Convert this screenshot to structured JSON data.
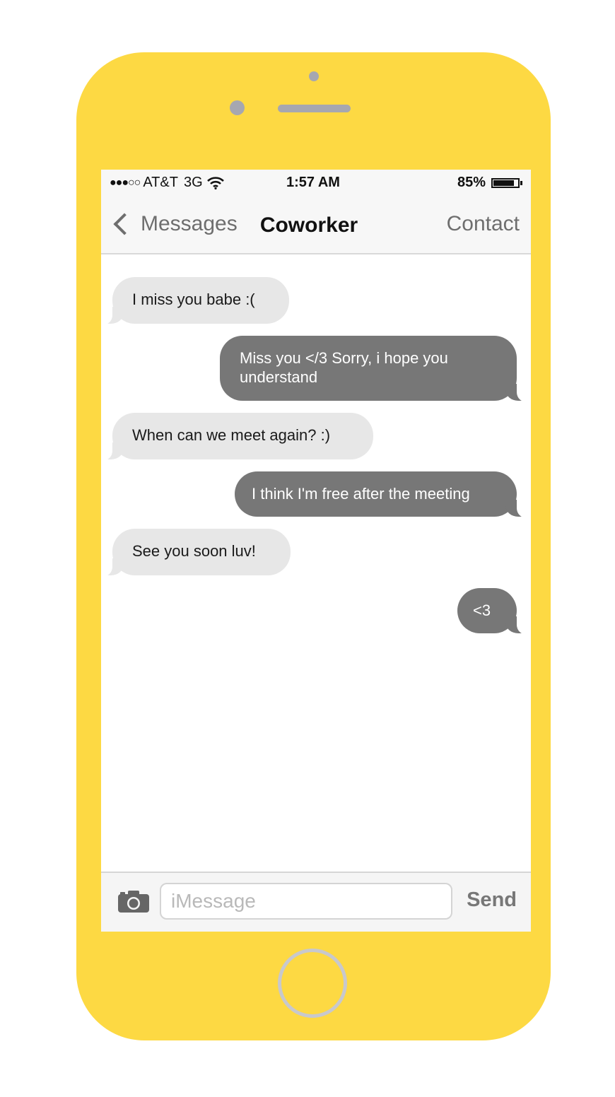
{
  "status_bar": {
    "signal": "●●●○○",
    "carrier": "AT&T",
    "network": "3G",
    "time": "1:57 AM",
    "battery_percent": "85%",
    "battery_level": 0.85
  },
  "nav": {
    "back_label": "Messages",
    "title": "Coworker",
    "contact_label": "Contact"
  },
  "messages": [
    {
      "direction": "received",
      "text": "I miss you babe :("
    },
    {
      "direction": "sent",
      "text": "Miss you </3 Sorry, i hope you understand"
    },
    {
      "direction": "received",
      "text": "When can we meet again? :)"
    },
    {
      "direction": "sent",
      "text": "I think I'm free after the meeting"
    },
    {
      "direction": "received",
      "text": "See you soon luv!"
    },
    {
      "direction": "sent",
      "text": "<3"
    }
  ],
  "composer": {
    "placeholder": "iMessage",
    "value": "",
    "send_label": "Send",
    "camera_icon": "camera-icon"
  },
  "colors": {
    "phone_body": "#fdd943",
    "sent_bubble": "#777777",
    "received_bubble": "#e7e7e7"
  }
}
